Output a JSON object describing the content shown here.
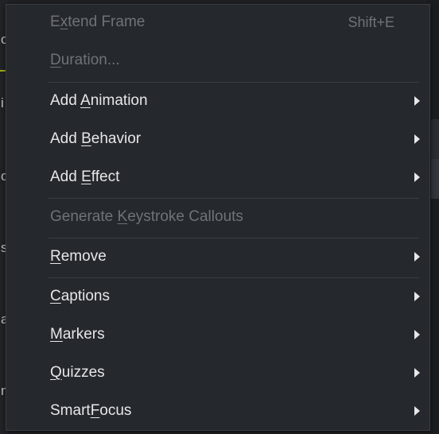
{
  "background": {
    "left_fragments": [
      "o",
      "i",
      "c",
      "s",
      "a",
      "n"
    ]
  },
  "menu": {
    "items": [
      {
        "pre": "E",
        "ul": "x",
        "post": "tend Frame",
        "shortcut": "Shift+E",
        "disabled": true,
        "submenu": false
      },
      {
        "pre": "",
        "ul": "D",
        "post": "uration...",
        "shortcut": "",
        "disabled": true,
        "submenu": false
      },
      {
        "pre": "Add ",
        "ul": "A",
        "post": "nimation",
        "shortcut": "",
        "disabled": false,
        "submenu": true
      },
      {
        "pre": "Add ",
        "ul": "B",
        "post": "ehavior",
        "shortcut": "",
        "disabled": false,
        "submenu": true
      },
      {
        "pre": "Add ",
        "ul": "E",
        "post": "ffect",
        "shortcut": "",
        "disabled": false,
        "submenu": true
      },
      {
        "pre": "Generate ",
        "ul": "K",
        "post": "eystroke Callouts",
        "shortcut": "",
        "disabled": true,
        "submenu": false
      },
      {
        "pre": "",
        "ul": "R",
        "post": "emove",
        "shortcut": "",
        "disabled": false,
        "submenu": true
      },
      {
        "pre": "",
        "ul": "C",
        "post": "aptions",
        "shortcut": "",
        "disabled": false,
        "submenu": true
      },
      {
        "pre": "",
        "ul": "M",
        "post": "arkers",
        "shortcut": "",
        "disabled": false,
        "submenu": true
      },
      {
        "pre": "",
        "ul": "Q",
        "post": "uizzes",
        "shortcut": "",
        "disabled": false,
        "submenu": true
      },
      {
        "pre": "Smart",
        "ul": "F",
        "post": "ocus",
        "shortcut": "",
        "disabled": false,
        "submenu": true
      }
    ]
  },
  "colors": {
    "menu_bg": "#25282c",
    "text_enabled": "#e6e7e9",
    "text_disabled": "#6f7378",
    "accent": "#a8b51b"
  }
}
